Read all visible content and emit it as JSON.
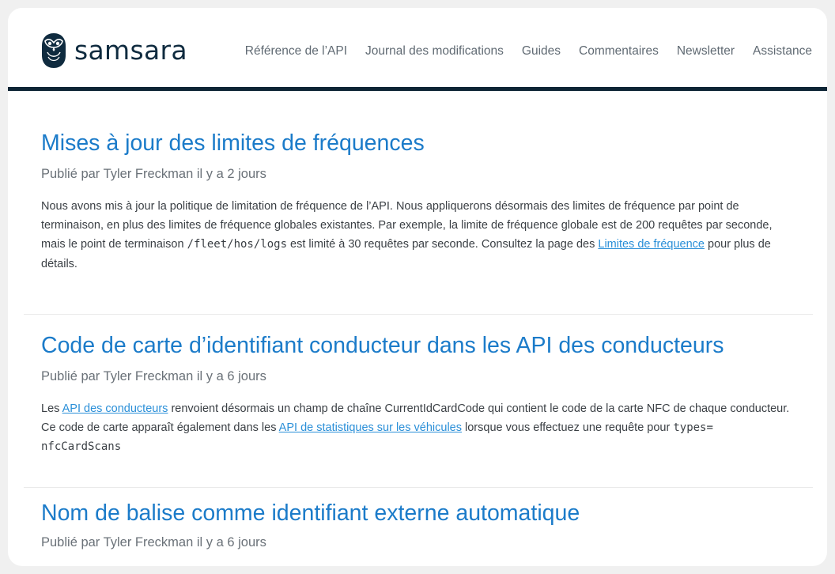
{
  "brand": {
    "name": "samsara",
    "primary_color": "#0f2b3f",
    "link_color": "#1b7bc9"
  },
  "nav": {
    "items": [
      {
        "label": "Référence de l’API"
      },
      {
        "label": "Journal des modifications"
      },
      {
        "label": "Guides"
      },
      {
        "label": "Commentaires"
      },
      {
        "label": "Newsletter"
      },
      {
        "label": "Assistance"
      }
    ]
  },
  "posts": [
    {
      "title": "Mises à jour des limites de fréquences",
      "byline": "Publié par Tyler Freckman il y a 2 jours",
      "body": {
        "t1": "Nous avons mis à jour la politique de limitation de fréquence de l’API. Nous appliquerons désormais des limites de fréquence par point de terminaison, en plus des limites de fréquence globales existantes. Par exemple, la limite de fréquence globale est de 200 requêtes par seconde, mais le point de terminaison ",
        "code": "/fleet/hos/logs",
        "t2": " est limité à 30 requêtes par seconde. Consultez la page des ",
        "link": "Limites de fréquence",
        "t3": " pour plus de détails."
      }
    },
    {
      "title": "Code de carte d’identifiant conducteur dans les API des conducteurs",
      "byline": "Publié par Tyler Freckman il y a 6 jours",
      "body": {
        "t1": "Les ",
        "link1": "API des conducteurs",
        "t2": " renvoient désormais un champ de chaîne CurrentIdCardCode qui contient le code de la carte NFC de chaque conducteur. Ce code de carte apparaît également dans les ",
        "link2": "API de statistiques sur les véhicules",
        "t3": " lorsque vous effectuez une requête pour ",
        "code": "types= nfcCardScans"
      }
    },
    {
      "title": "Nom de balise comme identifiant externe automatique",
      "byline": "Publié par Tyler Freckman il y a 6 jours"
    }
  ]
}
